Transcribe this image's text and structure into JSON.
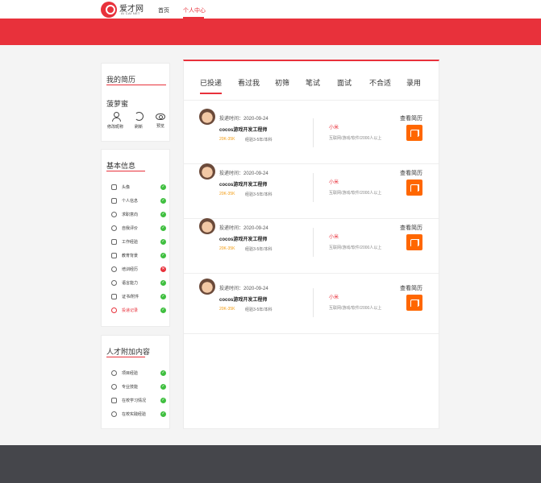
{
  "header": {
    "logo_cn": "爱才网",
    "logo_en": "AI CAI NET",
    "nav": [
      "首页",
      "个人中心"
    ]
  },
  "resume": {
    "title": "我的简历",
    "name": "菠萝蜜",
    "actions": [
      {
        "label": "修改昵称",
        "icon": "person-icon"
      },
      {
        "label": "刷新",
        "icon": "refresh-icon"
      },
      {
        "label": "预览",
        "icon": "eye-icon"
      }
    ]
  },
  "basic": {
    "title": "基本信息",
    "items": [
      {
        "label": "头像",
        "status": "ok"
      },
      {
        "label": "个人信息",
        "status": "ok"
      },
      {
        "label": "求职意向",
        "status": "ok"
      },
      {
        "label": "自我评价",
        "status": "ok"
      },
      {
        "label": "工作经验",
        "status": "ok"
      },
      {
        "label": "教育背景",
        "status": "ok"
      },
      {
        "label": "培训经历",
        "status": "missing"
      },
      {
        "label": "语言能力",
        "status": "ok"
      },
      {
        "label": "证书/附件",
        "status": "ok"
      },
      {
        "label": "投递记录",
        "status": "ok"
      }
    ]
  },
  "extra": {
    "title": "人才附加内容",
    "items": [
      {
        "label": "项目经验",
        "status": "ok"
      },
      {
        "label": "专业技能",
        "status": "ok"
      },
      {
        "label": "在校学习情况",
        "status": "ok"
      },
      {
        "label": "在校实践经验",
        "status": "ok"
      }
    ]
  },
  "tabs": [
    "已投递",
    "看过我",
    "初筛",
    "笔试",
    "面试",
    "不合适",
    "录用"
  ],
  "applications": [
    {
      "time": "投递时间：2020-09-24",
      "job": "cocos游戏开发工程师",
      "salary": "20K-35K",
      "req": "经验3-5年/本科",
      "company": "小米",
      "industry": "互联网/游戏/软件/2000人以上",
      "view": "查看简历"
    },
    {
      "time": "投递时间：2020-09-24",
      "job": "cocos游戏开发工程师",
      "salary": "20K-35K",
      "req": "经验3-5年/本科",
      "company": "小米",
      "industry": "互联网/游戏/软件/2000人以上",
      "view": "查看简历"
    },
    {
      "time": "投递时间：2020-09-24",
      "job": "cocos游戏开发工程师",
      "salary": "20K-35K",
      "req": "经验3-5年/本科",
      "company": "小米",
      "industry": "互联网/游戏/软件/2000人以上",
      "view": "查看简历"
    },
    {
      "time": "投递时间：2020-09-24",
      "job": "cocos游戏开发工程师",
      "salary": "20K-35K",
      "req": "经验3-5年/本科",
      "company": "小米",
      "industry": "互联网/游戏/软件/2000人以上",
      "view": "查看简历"
    }
  ],
  "colors": {
    "brand": "#e8313b",
    "salary": "#f39c12",
    "ok": "#3fbf3f",
    "company_logo": "#ff6700"
  }
}
